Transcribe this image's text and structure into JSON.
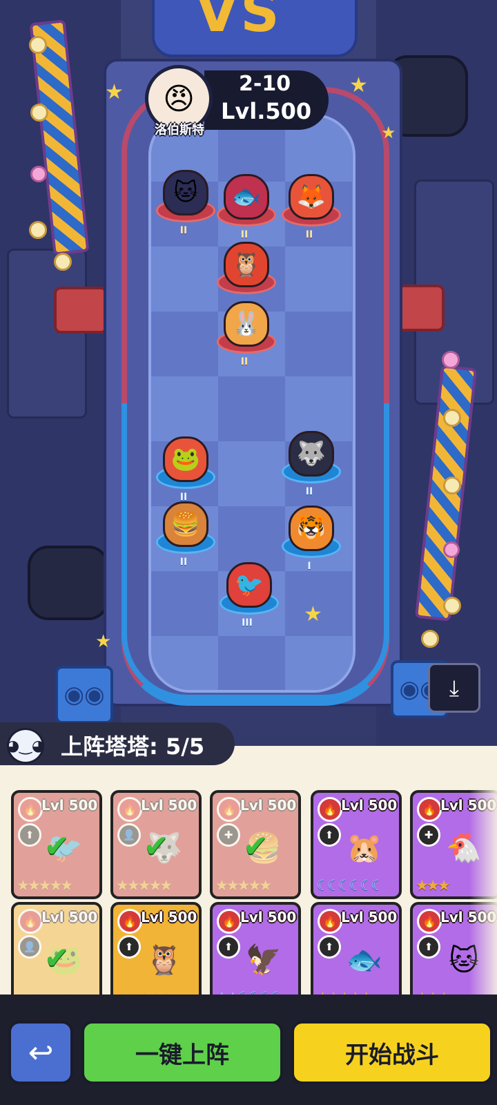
{
  "boss": {
    "name": "洛伯斯特",
    "stage": "2-10",
    "level": "Lvl.500",
    "avatar_icon": "masked-hero-icon"
  },
  "enemy_units": [
    {
      "icon": "🐱",
      "tier": "II",
      "color": "#2b2d55"
    },
    {
      "icon": "🐟",
      "tier": "II",
      "color": "#c0304f"
    },
    {
      "icon": "🦊",
      "tier": "II",
      "color": "#e8543a"
    },
    {
      "icon": "🦉",
      "tier": "",
      "color": "#e2452f"
    },
    {
      "icon": "🐰",
      "tier": "II",
      "color": "#f2a64a"
    }
  ],
  "player_units": [
    {
      "icon": "🐸",
      "tier": "II",
      "color": "#e8543a"
    },
    {
      "icon": "🐺",
      "tier": "II",
      "color": "#2b2d44"
    },
    {
      "icon": "🍔",
      "tier": "II",
      "color": "#d9843a"
    },
    {
      "icon": "🐯",
      "tier": "I",
      "color": "#f08a2e"
    },
    {
      "icon": "🐦",
      "tier": "III",
      "color": "#e0413b"
    }
  ],
  "team": {
    "label": "上阵塔塔: 5/5",
    "icon": "robot-cat-icon"
  },
  "cards": [
    {
      "level": "Lvl 500",
      "style": "red",
      "used": true,
      "role": "⬆",
      "icon": "🐦",
      "stars": "★★★★★",
      "star_style": "star"
    },
    {
      "level": "Lvl 500",
      "style": "red",
      "used": true,
      "role": "👤",
      "icon": "🐺",
      "stars": "★★★★★",
      "star_style": "star"
    },
    {
      "level": "Lvl 500",
      "style": "red",
      "used": true,
      "role": "✚",
      "icon": "🍔",
      "stars": "★★★★★",
      "star_style": "star"
    },
    {
      "level": "Lvl 500",
      "style": "purple",
      "used": false,
      "role": "⬆",
      "icon": "🐹",
      "stars": "☾☾☾☾☾☾",
      "star_style": "moon"
    },
    {
      "level": "Lvl 500",
      "style": "purple",
      "used": false,
      "role": "✚",
      "icon": "🐔",
      "stars": "★★★",
      "star_style": "star"
    },
    {
      "level": "Lvl 500",
      "style": "gold",
      "used": true,
      "role": "👤",
      "icon": "🐸",
      "stars": "★★★★★",
      "star_style": "star"
    },
    {
      "level": "Lvl 500",
      "style": "gold",
      "used": false,
      "role": "⬆",
      "icon": "🦉",
      "stars": "★★★★★",
      "star_style": "star"
    },
    {
      "level": "Lvl 500",
      "style": "purple",
      "used": false,
      "role": "⬆",
      "icon": "🦅",
      "stars": "★★☾☾☾☾",
      "star_style": "moon"
    },
    {
      "level": "Lvl 500",
      "style": "purple",
      "used": false,
      "role": "⬆",
      "icon": "🐟",
      "stars": "★★★★★",
      "star_style": "star"
    },
    {
      "level": "Lvl 500",
      "style": "purple",
      "used": false,
      "role": "⬆",
      "icon": "🐱",
      "stars": "★★★",
      "star_style": "star"
    }
  ],
  "buttons": {
    "back_icon": "↩",
    "auto_deploy": "一键上阵",
    "start_battle": "开始战斗",
    "save_icon": "⤓"
  },
  "decor": {
    "vs_text": "VS"
  }
}
